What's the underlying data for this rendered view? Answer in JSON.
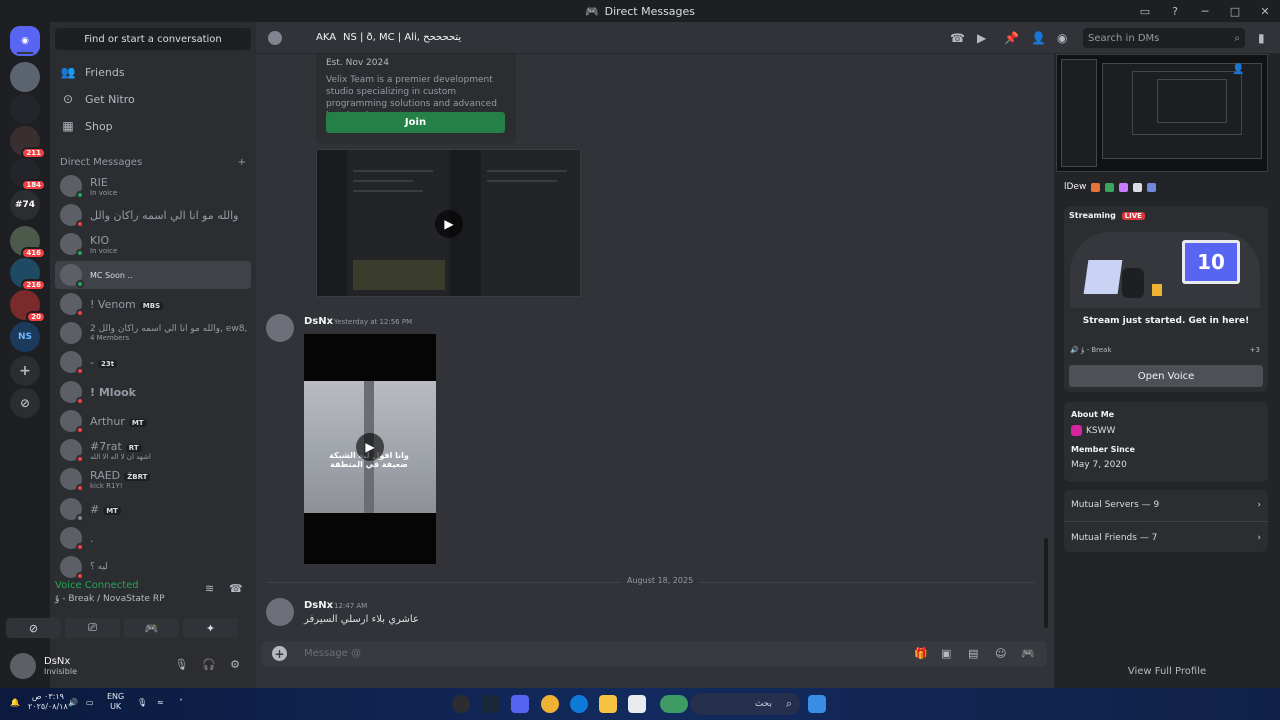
{
  "window": {
    "title": "Direct Messages"
  },
  "servers": [
    {
      "label": ""
    },
    {
      "label": "",
      "badge": ""
    },
    {
      "label": "",
      "badge": "211"
    },
    {
      "label": "",
      "badge": "184"
    },
    {
      "label": "#74"
    },
    {
      "label": "",
      "badge": "416"
    },
    {
      "label": "",
      "badge": "216"
    },
    {
      "label": "",
      "badge": "20"
    },
    {
      "label": "NS"
    }
  ],
  "sidebar": {
    "find_placeholder": "Find or start a conversation",
    "nav": [
      {
        "label": "Friends",
        "icon": "friends-icon"
      },
      {
        "label": "Get Nitro",
        "icon": "nitro-icon"
      },
      {
        "label": "Shop",
        "icon": "shop-icon"
      }
    ],
    "dm_header": "Direct Messages",
    "dms": [
      {
        "name": "RIE",
        "sub": "In voice",
        "status": "on"
      },
      {
        "name": "والله مو انا الي اسمه راكان والل",
        "sub": "",
        "status": "dnd"
      },
      {
        "name": "KIO",
        "sub": "In voice",
        "status": "on"
      },
      {
        "name": "MC Soon ..",
        "sub": "",
        "status": "on",
        "active": true
      },
      {
        "name": "! Venom",
        "tag": "MBS",
        "sub": "",
        "status": "dnd"
      },
      {
        "name": "2 والله مو انا الي اسمه راكان والل, ew8, !...",
        "sub": "4 Members",
        "status": "group"
      },
      {
        "name": "-",
        "tag": "23t",
        "sub": "",
        "status": "dnd"
      },
      {
        "name": "! Mlook",
        "sub": "",
        "status": "dnd"
      },
      {
        "name": "Arthur",
        "tag": "MT",
        "sub": "",
        "status": "dnd"
      },
      {
        "name": "#7rat",
        "tag": "RT",
        "sub": "اشهد ان لا اله الا الله",
        "status": "dnd"
      },
      {
        "name": "RAED",
        "tag": "ŽBRT",
        "sub": "kick R1Y!",
        "status": "dnd"
      },
      {
        "name": "#",
        "tag": "MT",
        "sub": "",
        "status": "off"
      },
      {
        "name": ".",
        "sub": "",
        "status": "dnd"
      },
      {
        "name": "ليه ؟",
        "sub": "",
        "status": "dnd"
      }
    ]
  },
  "voice": {
    "title": "Voice Connected",
    "channel": "ۇ - Break",
    "server": "/ NovaState RP"
  },
  "user": {
    "name": "DsNx",
    "status": "Invisible"
  },
  "header": {
    "prefix": "AKA",
    "name": "NS | ð, MC | Ali, يتححححح",
    "search_placeholder": "Search in DMs"
  },
  "chat": {
    "invite": {
      "est": "Est. Nov 2024",
      "desc": "Velix Team is a premier development studio specializing in custom programming solutions and advanced bot development",
      "join": "Join"
    },
    "messages": [
      {
        "author": "DsNx",
        "time": "Yesterday at 12:56 PM",
        "caption": "وانا اقول ليه الشبكة ضعيفة في المنطقة"
      },
      {
        "author": "DsNx",
        "time": "12:47 AM",
        "text": "عاشري بلاء ارسلي السيرفر"
      }
    ],
    "date_divider": "August 18, 2025",
    "composer_placeholder": "Message @"
  },
  "profile": {
    "name": "lDew",
    "streaming_label": "Streaming",
    "live": "LIVE",
    "screen_text": "10",
    "stream_caption": "Stream just started. Get in here!",
    "stream_channel": "ۇ - Break",
    "stream_count": "+3",
    "open_voice": "Open Voice",
    "about_label": "About Me",
    "about_value": "KSWW",
    "member_since_label": "Member Since",
    "member_since_value": "May 7, 2020",
    "mutual_servers": "Mutual Servers — 9",
    "mutual_friends": "Mutual Friends — 7",
    "view_full": "View Full Profile"
  },
  "taskbar": {
    "search": "بحث",
    "lang": "ENG",
    "region": "UK",
    "time": "٠٣:١٩ ص",
    "date": "٢٠٢٥/٠٨/١٨"
  }
}
